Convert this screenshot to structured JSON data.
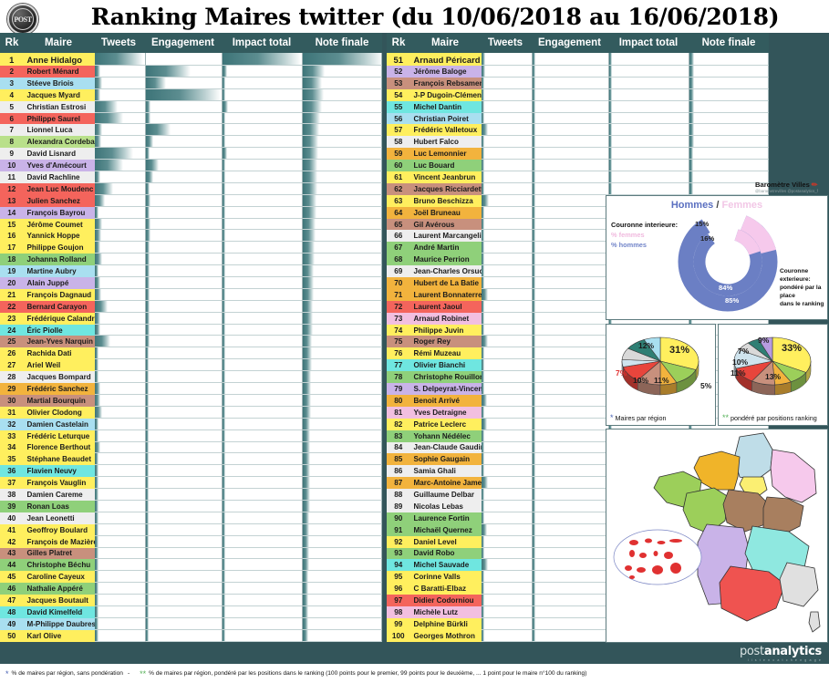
{
  "header": {
    "title": "Ranking Maires twitter (du 10/06/2018 au 16/06/2018)",
    "logo_text": "POST"
  },
  "columns": {
    "rk": "Rk",
    "maire": "Maire",
    "tweets": "Tweets",
    "engagement": "Engagement",
    "impact": "Impact total",
    "note": "Note finale"
  },
  "rows_left": [
    {
      "rk": "1",
      "name": "Anne Hidalgo",
      "color": "#ffef5e",
      "tw": 38,
      "eng": 0,
      "imp": 60,
      "note": 100
    },
    {
      "rk": "2",
      "name": "Robert Ménard",
      "color": "#f4645c",
      "tw": 4,
      "eng": 36,
      "imp": 3,
      "note": 28
    },
    {
      "rk": "3",
      "name": "Stéeve Briois",
      "color": "#a9dff0",
      "tw": 6,
      "eng": 16,
      "imp": 2,
      "note": 24
    },
    {
      "rk": "4",
      "name": "Jacques Myard",
      "color": "#ffef5e",
      "tw": 4,
      "eng": 60,
      "imp": 2,
      "note": 26
    },
    {
      "rk": "5",
      "name": "Christian Estrosi",
      "color": "#eeeeee",
      "tw": 18,
      "eng": 4,
      "imp": 4,
      "note": 24
    },
    {
      "rk": "6",
      "name": "Philippe Saurel",
      "color": "#f4645c",
      "tw": 22,
      "eng": 4,
      "imp": 2,
      "note": 22
    },
    {
      "rk": "7",
      "name": "Lionnel Luca",
      "color": "#eeeeee",
      "tw": 6,
      "eng": 20,
      "imp": 2,
      "note": 21
    },
    {
      "rk": "8",
      "name": "Alexandra Cordebard",
      "color": "#b9e08a",
      "tw": 5,
      "eng": 6,
      "imp": 2,
      "note": 20
    },
    {
      "rk": "9",
      "name": "David Lisnard",
      "color": "#eeeeee",
      "tw": 30,
      "eng": 3,
      "imp": 3,
      "note": 20
    },
    {
      "rk": "10",
      "name": "Yves d'Amécourt",
      "color": "#c9b3e8",
      "tw": 22,
      "eng": 10,
      "imp": 2,
      "note": 19
    },
    {
      "rk": "11",
      "name": "David Rachline",
      "color": "#eeeeee",
      "tw": 4,
      "eng": 6,
      "imp": 2,
      "note": 18
    },
    {
      "rk": "12",
      "name": "Jean Luc Moudenc",
      "color": "#f4645c",
      "tw": 14,
      "eng": 3,
      "imp": 2,
      "note": 18
    },
    {
      "rk": "13",
      "name": "Julien Sanchez",
      "color": "#f4645c",
      "tw": 8,
      "eng": 4,
      "imp": 2,
      "note": 17
    },
    {
      "rk": "14",
      "name": "François Bayrou",
      "color": "#c9b3e8",
      "tw": 3,
      "eng": 3,
      "imp": 2,
      "note": 17
    },
    {
      "rk": "15",
      "name": "Jérôme Coumet",
      "color": "#ffef5e",
      "tw": 6,
      "eng": 4,
      "imp": 2,
      "note": 16
    },
    {
      "rk": "16",
      "name": "Yannick Hoppe",
      "color": "#ffef5e",
      "tw": 5,
      "eng": 4,
      "imp": 2,
      "note": 16
    },
    {
      "rk": "17",
      "name": "Philippe Goujon",
      "color": "#ffef5e",
      "tw": 4,
      "eng": 3,
      "imp": 2,
      "note": 15
    },
    {
      "rk": "18",
      "name": "Johanna Rolland",
      "color": "#8fd07a",
      "tw": 6,
      "eng": 3,
      "imp": 2,
      "note": 15
    },
    {
      "rk": "19",
      "name": "Martine Aubry",
      "color": "#a9dff0",
      "tw": 3,
      "eng": 3,
      "imp": 2,
      "note": 14
    },
    {
      "rk": "20",
      "name": "Alain Juppé",
      "color": "#c9b3e8",
      "tw": 4,
      "eng": 3,
      "imp": 2,
      "note": 14
    },
    {
      "rk": "21",
      "name": "François Dagnaud",
      "color": "#ffef5e",
      "tw": 5,
      "eng": 3,
      "imp": 2,
      "note": 14
    },
    {
      "rk": "22",
      "name": "Bernard Carayon",
      "color": "#f4645c",
      "tw": 10,
      "eng": 3,
      "imp": 2,
      "note": 13
    },
    {
      "rk": "23",
      "name": "Frédérique Calandra",
      "color": "#ffef5e",
      "tw": 4,
      "eng": 3,
      "imp": 2,
      "note": 13
    },
    {
      "rk": "24",
      "name": "Éric Piolle",
      "color": "#6fe6e0",
      "tw": 4,
      "eng": 3,
      "imp": 2,
      "note": 13
    },
    {
      "rk": "25",
      "name": "Jean-Yves Narquin",
      "color": "#c8907d",
      "tw": 12,
      "eng": 3,
      "imp": 2,
      "note": 12
    },
    {
      "rk": "26",
      "name": "Rachida Dati",
      "color": "#ffef5e",
      "tw": 3,
      "eng": 2,
      "imp": 2,
      "note": 12
    },
    {
      "rk": "27",
      "name": "Ariel Weil",
      "color": "#ffef5e",
      "tw": 3,
      "eng": 2,
      "imp": 2,
      "note": 12
    },
    {
      "rk": "28",
      "name": "Jacques Bompard",
      "color": "#eeeeee",
      "tw": 3,
      "eng": 2,
      "imp": 2,
      "note": 11
    },
    {
      "rk": "29",
      "name": "Frédéric Sanchez",
      "color": "#f2b33d",
      "tw": 4,
      "eng": 2,
      "imp": 2,
      "note": 11
    },
    {
      "rk": "30",
      "name": "Martial Bourquin",
      "color": "#c8907d",
      "tw": 4,
      "eng": 2,
      "imp": 2,
      "note": 11
    },
    {
      "rk": "31",
      "name": "Olivier Clodong",
      "color": "#ffef5e",
      "tw": 6,
      "eng": 2,
      "imp": 2,
      "note": 11
    },
    {
      "rk": "32",
      "name": "Damien Castelain",
      "color": "#a9dff0",
      "tw": 3,
      "eng": 2,
      "imp": 2,
      "note": 10
    },
    {
      "rk": "33",
      "name": "Frédéric Leturque",
      "color": "#ffef5e",
      "tw": 3,
      "eng": 2,
      "imp": 2,
      "note": 10
    },
    {
      "rk": "34",
      "name": "Florence Berthout",
      "color": "#ffef5e",
      "tw": 4,
      "eng": 2,
      "imp": 2,
      "note": 10
    },
    {
      "rk": "35",
      "name": "Stéphane Beaudet",
      "color": "#ffef5e",
      "tw": 3,
      "eng": 2,
      "imp": 2,
      "note": 10
    },
    {
      "rk": "36",
      "name": "Flavien Neuvy",
      "color": "#6fe6e0",
      "tw": 3,
      "eng": 2,
      "imp": 2,
      "note": 9
    },
    {
      "rk": "37",
      "name": "François Vauglin",
      "color": "#ffef5e",
      "tw": 3,
      "eng": 2,
      "imp": 2,
      "note": 9
    },
    {
      "rk": "38",
      "name": "Damien Careme",
      "color": "#eeeeee",
      "tw": 3,
      "eng": 2,
      "imp": 2,
      "note": 9
    },
    {
      "rk": "39",
      "name": "Ronan Loas",
      "color": "#8fd07a",
      "tw": 3,
      "eng": 2,
      "imp": 2,
      "note": 9
    },
    {
      "rk": "40",
      "name": "Jean Leonetti",
      "color": "#eeeeee",
      "tw": 3,
      "eng": 2,
      "imp": 2,
      "note": 8
    },
    {
      "rk": "41",
      "name": "Geoffroy Boulard",
      "color": "#ffef5e",
      "tw": 3,
      "eng": 2,
      "imp": 2,
      "note": 8
    },
    {
      "rk": "42",
      "name": "François de Mazière",
      "color": "#ffef5e",
      "tw": 3,
      "eng": 2,
      "imp": 2,
      "note": 8
    },
    {
      "rk": "43",
      "name": "Gilles Platret",
      "color": "#c8907d",
      "tw": 3,
      "eng": 2,
      "imp": 2,
      "note": 8
    },
    {
      "rk": "44",
      "name": "Christophe Béchu",
      "color": "#8fd07a",
      "tw": 3,
      "eng": 2,
      "imp": 2,
      "note": 8
    },
    {
      "rk": "45",
      "name": "Caroline Cayeux",
      "color": "#ffef5e",
      "tw": 3,
      "eng": 2,
      "imp": 2,
      "note": 7
    },
    {
      "rk": "46",
      "name": "Nathalie Appéré",
      "color": "#8fd07a",
      "tw": 3,
      "eng": 2,
      "imp": 2,
      "note": 7
    },
    {
      "rk": "47",
      "name": "Jacques Boutault",
      "color": "#ffef5e",
      "tw": 3,
      "eng": 2,
      "imp": 2,
      "note": 7
    },
    {
      "rk": "48",
      "name": "David Kimelfeld",
      "color": "#6fe6e0",
      "tw": 3,
      "eng": 2,
      "imp": 2,
      "note": 7
    },
    {
      "rk": "49",
      "name": "M-Philippe Daubresse",
      "color": "#a9dff0",
      "tw": 3,
      "eng": 2,
      "imp": 2,
      "note": 7
    },
    {
      "rk": "50",
      "name": "Karl Olive",
      "color": "#ffef5e",
      "tw": 3,
      "eng": 2,
      "imp": 2,
      "note": 7
    }
  ],
  "rows_right": [
    {
      "rk": "51",
      "name": "Arnaud Péricard",
      "color": "#ffef5e",
      "tw": 3,
      "eng": 2,
      "imp": 2,
      "note": 6
    },
    {
      "rk": "52",
      "name": "Jérôme Baloge",
      "color": "#c9b3e8",
      "tw": 3,
      "eng": 2,
      "imp": 2,
      "note": 6
    },
    {
      "rk": "53",
      "name": "François Rebsamen",
      "color": "#c8907d",
      "tw": 2,
      "eng": 2,
      "imp": 2,
      "note": 6
    },
    {
      "rk": "54",
      "name": "J-P Dugoin-Clément",
      "color": "#ffef5e",
      "tw": 2,
      "eng": 2,
      "imp": 2,
      "note": 6
    },
    {
      "rk": "55",
      "name": "Michel Dantin",
      "color": "#6fe6e0",
      "tw": 2,
      "eng": 2,
      "imp": 2,
      "note": 6
    },
    {
      "rk": "56",
      "name": "Christian Poiret",
      "color": "#a9dff0",
      "tw": 2,
      "eng": 2,
      "imp": 2,
      "note": 6
    },
    {
      "rk": "57",
      "name": "Frédéric Valletoux",
      "color": "#ffef5e",
      "tw": 5,
      "eng": 2,
      "imp": 2,
      "note": 6
    },
    {
      "rk": "58",
      "name": "Hubert Falco",
      "color": "#eeeeee",
      "tw": 2,
      "eng": 2,
      "imp": 2,
      "note": 6
    },
    {
      "rk": "59",
      "name": "Luc Lemonnier",
      "color": "#f2b33d",
      "tw": 2,
      "eng": 2,
      "imp": 2,
      "note": 5
    },
    {
      "rk": "60",
      "name": "Luc Bouard",
      "color": "#8fd07a",
      "tw": 2,
      "eng": 2,
      "imp": 2,
      "note": 5
    },
    {
      "rk": "61",
      "name": "Vincent Jeanbrun",
      "color": "#ffef5e",
      "tw": 2,
      "eng": 2,
      "imp": 2,
      "note": 5
    },
    {
      "rk": "62",
      "name": "Jacques Ricciardetti",
      "color": "#c8907d",
      "tw": 2,
      "eng": 2,
      "imp": 2,
      "note": 5
    },
    {
      "rk": "63",
      "name": "Bruno Beschizza",
      "color": "#ffef5e",
      "tw": 6,
      "eng": 2,
      "imp": 2,
      "note": 5
    },
    {
      "rk": "64",
      "name": "Joël Bruneau",
      "color": "#f2b33d",
      "tw": 2,
      "eng": 2,
      "imp": 2,
      "note": 5
    },
    {
      "rk": "65",
      "name": "Gil Avérous",
      "color": "#c8907d",
      "tw": 2,
      "eng": 2,
      "imp": 2,
      "note": 5
    },
    {
      "rk": "66",
      "name": "Laurent Marcangeli",
      "color": "#eeeeee",
      "tw": 2,
      "eng": 2,
      "imp": 2,
      "note": 5
    },
    {
      "rk": "67",
      "name": "André Martin",
      "color": "#8fd07a",
      "tw": 2,
      "eng": 2,
      "imp": 2,
      "note": 5
    },
    {
      "rk": "68",
      "name": "Maurice Perrion",
      "color": "#8fd07a",
      "tw": 2,
      "eng": 2,
      "imp": 2,
      "note": 5
    },
    {
      "rk": "69",
      "name": "Jean-Charles Orsucci",
      "color": "#eeeeee",
      "tw": 2,
      "eng": 2,
      "imp": 2,
      "note": 4
    },
    {
      "rk": "70",
      "name": "Hubert de La Batie",
      "color": "#f2b33d",
      "tw": 2,
      "eng": 2,
      "imp": 2,
      "note": 4
    },
    {
      "rk": "71",
      "name": "Laurent Bonnaterre",
      "color": "#f2b33d",
      "tw": 5,
      "eng": 2,
      "imp": 2,
      "note": 4
    },
    {
      "rk": "72",
      "name": "Laurent Jaoul",
      "color": "#f4645c",
      "tw": 2,
      "eng": 2,
      "imp": 2,
      "note": 4
    },
    {
      "rk": "73",
      "name": "Arnaud Robinet",
      "color": "#f2bfe0",
      "tw": 2,
      "eng": 2,
      "imp": 2,
      "note": 4
    },
    {
      "rk": "74",
      "name": "Philippe Juvin",
      "color": "#ffef5e",
      "tw": 2,
      "eng": 2,
      "imp": 2,
      "note": 4
    },
    {
      "rk": "75",
      "name": "Roger Rey",
      "color": "#c8907d",
      "tw": 5,
      "eng": 2,
      "imp": 2,
      "note": 4
    },
    {
      "rk": "76",
      "name": "Rémi Muzeau",
      "color": "#ffef5e",
      "tw": 2,
      "eng": 2,
      "imp": 2,
      "note": 4
    },
    {
      "rk": "77",
      "name": "Olivier Bianchi",
      "color": "#6fe6e0",
      "tw": 2,
      "eng": 2,
      "imp": 2,
      "note": 4
    },
    {
      "rk": "78",
      "name": "Christophe Rouillon",
      "color": "#8fd07a",
      "tw": 2,
      "eng": 2,
      "imp": 2,
      "note": 4
    },
    {
      "rk": "79",
      "name": "S. Delpeyrat-Vincent",
      "color": "#c9b3e8",
      "tw": 2,
      "eng": 2,
      "imp": 2,
      "note": 4
    },
    {
      "rk": "80",
      "name": "Benoit Arrivé",
      "color": "#f2b33d",
      "tw": 4,
      "eng": 2,
      "imp": 2,
      "note": 4
    },
    {
      "rk": "81",
      "name": "Yves Detraigne",
      "color": "#f2bfe0",
      "tw": 2,
      "eng": 2,
      "imp": 2,
      "note": 4
    },
    {
      "rk": "82",
      "name": "Patrice Leclerc",
      "color": "#ffef5e",
      "tw": 4,
      "eng": 2,
      "imp": 2,
      "note": 4
    },
    {
      "rk": "83",
      "name": "Yohann Nédélec",
      "color": "#8fd07a",
      "tw": 2,
      "eng": 2,
      "imp": 2,
      "note": 3
    },
    {
      "rk": "84",
      "name": "Jean-Claude Gaudin",
      "color": "#eeeeee",
      "tw": 2,
      "eng": 2,
      "imp": 2,
      "note": 3
    },
    {
      "rk": "85",
      "name": "Sophie Gaugain",
      "color": "#f2b33d",
      "tw": 2,
      "eng": 2,
      "imp": 2,
      "note": 3
    },
    {
      "rk": "86",
      "name": "Samia Ghali",
      "color": "#eeeeee",
      "tw": 2,
      "eng": 2,
      "imp": 2,
      "note": 3
    },
    {
      "rk": "87",
      "name": "Marc-Antoine Jamet",
      "color": "#f2b33d",
      "tw": 5,
      "eng": 2,
      "imp": 2,
      "note": 3
    },
    {
      "rk": "88",
      "name": "Guillaume Delbar",
      "color": "#eeeeee",
      "tw": 2,
      "eng": 2,
      "imp": 2,
      "note": 3
    },
    {
      "rk": "89",
      "name": "Nicolas Lebas",
      "color": "#eeeeee",
      "tw": 2,
      "eng": 2,
      "imp": 2,
      "note": 3
    },
    {
      "rk": "90",
      "name": "Laurence Fortin",
      "color": "#8fd07a",
      "tw": 2,
      "eng": 2,
      "imp": 2,
      "note": 3
    },
    {
      "rk": "91",
      "name": "Michaël Quernez",
      "color": "#8fd07a",
      "tw": 4,
      "eng": 2,
      "imp": 2,
      "note": 3
    },
    {
      "rk": "92",
      "name": "Daniel Level",
      "color": "#ffef5e",
      "tw": 2,
      "eng": 2,
      "imp": 2,
      "note": 3
    },
    {
      "rk": "93",
      "name": "David Robo",
      "color": "#8fd07a",
      "tw": 2,
      "eng": 2,
      "imp": 2,
      "note": 3
    },
    {
      "rk": "94",
      "name": "Michel Sauvade",
      "color": "#6fe6e0",
      "tw": 5,
      "eng": 2,
      "imp": 2,
      "note": 3
    },
    {
      "rk": "95",
      "name": "Corinne Valls",
      "color": "#ffef5e",
      "tw": 2,
      "eng": 2,
      "imp": 2,
      "note": 3
    },
    {
      "rk": "96",
      "name": "C Baratti-Elbaz",
      "color": "#ffef5e",
      "tw": 2,
      "eng": 2,
      "imp": 2,
      "note": 3
    },
    {
      "rk": "97",
      "name": "Didier Codorniou",
      "color": "#f4645c",
      "tw": 2,
      "eng": 2,
      "imp": 2,
      "note": 3
    },
    {
      "rk": "98",
      "name": "Michèle Lutz",
      "color": "#f2bfe0",
      "tw": 2,
      "eng": 2,
      "imp": 2,
      "note": 3
    },
    {
      "rk": "99",
      "name": "Delphine Bürkli",
      "color": "#ffef5e",
      "tw": 2,
      "eng": 2,
      "imp": 2,
      "note": 3
    },
    {
      "rk": "100",
      "name": "Georges Mothron",
      "color": "#ffef5e",
      "tw": 2,
      "eng": 2,
      "imp": 2,
      "note": 3
    }
  ],
  "barometre": {
    "name": "Baromètre Villes",
    "handles": "@barometrevilles @postanalytics_f",
    "pencil_icon": "pencil-icon"
  },
  "donut": {
    "title_men": "Hommes",
    "title_sep": "/",
    "title_women": "Femmes",
    "legend_line1": "Couronne interieure:",
    "legend_line2": "% femmes",
    "legend_line3": "% hommes",
    "right_line1": "Couronne exterieure:",
    "right_line2": "pondéré par la place",
    "right_line3": "dans le ranking",
    "inner_women": "15%",
    "outer_women": "16%",
    "inner_men": "84%",
    "outer_men": "85%",
    "color_men": "#6b7fc4",
    "color_women": "#f6c9ec"
  },
  "chart_data": [
    {
      "type": "pie",
      "title": "Maires par région",
      "caption": "Maires par région",
      "star": "*",
      "labels": [
        "31%",
        "12%",
        "7%",
        "10%",
        "11%",
        "5%"
      ],
      "values": [
        31,
        12,
        7,
        10,
        11,
        5,
        8,
        9,
        7
      ],
      "colors": [
        "#ffef5e",
        "#9ccf5a",
        "#f2b33d",
        "#c8907d",
        "#e8453c",
        "#cfe4ee",
        "#d9d9d9",
        "#2f7f74",
        "#a9dff0"
      ],
      "legend": "off"
    },
    {
      "type": "pie",
      "title": "pondéré par positions ranking",
      "caption": "pondéré par positions ranking",
      "star": "**",
      "labels": [
        "33%",
        "9%",
        "7%",
        "10%",
        "11%",
        "13%"
      ],
      "values": [
        33,
        9,
        7,
        10,
        11,
        13,
        6,
        5,
        6
      ],
      "colors": [
        "#ffef5e",
        "#9ccf5a",
        "#f2b33d",
        "#c8907d",
        "#e8453c",
        "#cfe4ee",
        "#d9d9d9",
        "#2f7f74",
        "#b79ce0"
      ],
      "legend": "off"
    },
    {
      "type": "pie",
      "title": "Hommes / Femmes",
      "labels": [
        "84%",
        "15%",
        "85%",
        "16%"
      ],
      "series": [
        {
          "name": "Couronne interieure",
          "values": [
            84,
            15
          ],
          "names": [
            "% hommes",
            "% femmes"
          ]
        },
        {
          "name": "Couronne exterieure",
          "values": [
            85,
            16
          ],
          "names": [
            "% hommes",
            "% femmes"
          ]
        }
      ],
      "colors": [
        "#6b7fc4",
        "#f6c9ec"
      ]
    }
  ],
  "map": {
    "name": "carte-de-france-regions",
    "regions": [
      {
        "name": "Hauts-de-France",
        "color": "#bfdde8"
      },
      {
        "name": "Normandie",
        "color": "#f0b429"
      },
      {
        "name": "Ile-de-France",
        "color": "#fbef72"
      },
      {
        "name": "Grand Est",
        "color": "#f6c9ec"
      },
      {
        "name": "Bretagne",
        "color": "#9ccf5a"
      },
      {
        "name": "Pays de la Loire",
        "color": "#9ccf5a"
      },
      {
        "name": "Centre-Val de Loire",
        "color": "#a87f5f"
      },
      {
        "name": "Bourgogne-Franche-Comté",
        "color": "#a87f5f"
      },
      {
        "name": "Nouvelle-Aquitaine",
        "color": "#c9b3e8"
      },
      {
        "name": "Auvergne-Rhône-Alpes",
        "color": "#8fe8e0"
      },
      {
        "name": "Occitanie",
        "color": "#ef5350"
      },
      {
        "name": "Provence-Alpes-Côte d'Azur",
        "color": "#e0e0e0"
      },
      {
        "name": "Corse",
        "color": "#e0e0e0"
      },
      {
        "name": "Outre-mer",
        "color": "#e03131"
      }
    ]
  },
  "footer": {
    "brand_prefix": "post",
    "brand_suffix": "analytics",
    "brand_tagline": "l i s t e n  c a t c h  e n g a g e",
    "star1": "*",
    "note1": "% de maires par région, sans pondération",
    "dash": "-",
    "star2": "**",
    "note2": "% de maires par région, pondéré par les positions dans le ranking (100 points  pour le premier, 99 points pour le deuxième, ... 1 point pour le maire n°100 du ranking)"
  }
}
